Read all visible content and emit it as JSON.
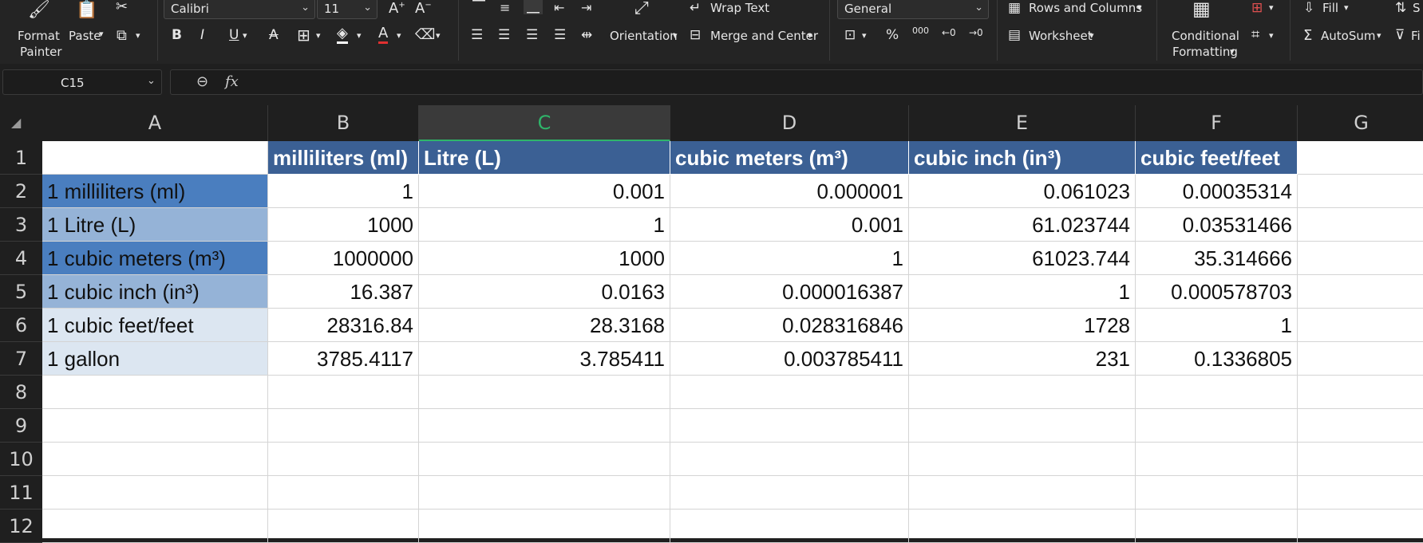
{
  "ribbon": {
    "format_painter": [
      "Format",
      "Painter"
    ],
    "paste": "Paste",
    "font_name": "Calibri",
    "font_size": "11",
    "wrap_text": "Wrap Text",
    "orientation": "Orientation",
    "merge_center": "Merge and Center",
    "number_format": "General",
    "rows_columns": "Rows and  Columns",
    "worksheet": "Worksheet",
    "conditional_formatting": [
      "Conditional",
      "Formatting"
    ],
    "fill": "Fill",
    "autosum": "AutoSum",
    "sort_partial": "S",
    "filter_partial": "Fi"
  },
  "formula_bar": {
    "name_box": "C15",
    "fx": "fx",
    "formula": ""
  },
  "columns": [
    "A",
    "B",
    "C",
    "D",
    "E",
    "F",
    "G"
  ],
  "selected_column": "C",
  "rows": [
    "1",
    "2",
    "3",
    "4",
    "5",
    "6",
    "7",
    "8",
    "9",
    "10",
    "11",
    "12"
  ],
  "colors": {
    "header_fill": "#3b6094",
    "row_label_fills": [
      "#4a7ebf",
      "#95b3d7",
      "#4a7ebf",
      "#95b3d7",
      "#dce6f1"
    ],
    "selected_column_accent": "#2fb56a"
  },
  "table": {
    "header": [
      "",
      "milliliters (ml)",
      "Litre (L)",
      "cubic meters (m³)",
      "cubic inch (in³)",
      "cubic feet/feet"
    ],
    "data": [
      [
        "1 milliliters (ml)",
        "1",
        "0.001",
        "0.000001",
        "0.061023",
        "0.00035314"
      ],
      [
        "1  Litre (L)",
        "1000",
        "1",
        "0.001",
        "61.023744",
        "0.03531466"
      ],
      [
        "1  cubic meters (m³)",
        "1000000",
        "1000",
        "1",
        "61023.744",
        "35.314666"
      ],
      [
        "1  cubic inch (in³)",
        "16.387",
        "0.0163",
        "0.000016387",
        "1",
        "0.000578703"
      ],
      [
        "1 cubic feet/feet",
        "28316.84",
        "28.3168",
        "0.028316846",
        "1728",
        "1"
      ],
      [
        "1 gallon",
        "3785.4117",
        "3.785411",
        "0.003785411",
        "231",
        "0.1336805"
      ]
    ]
  }
}
